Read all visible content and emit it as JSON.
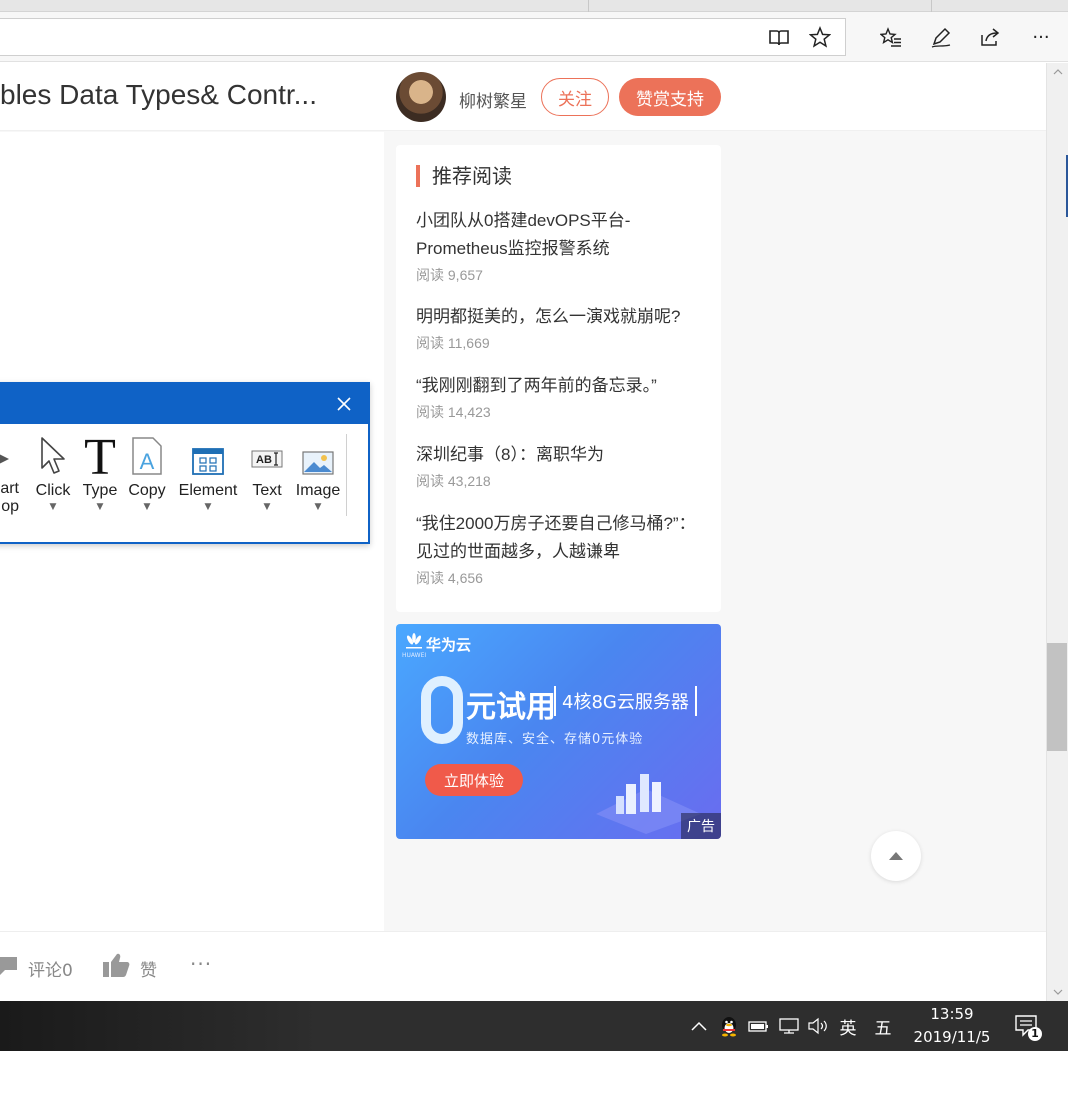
{
  "browser": {
    "toolbar_icons": [
      "reading-view-icon",
      "favorite-star-icon",
      "favorites-list-icon",
      "pen-icon",
      "share-icon",
      "more-icon"
    ],
    "more_label": "···"
  },
  "article": {
    "title": "bles Data Types& Contr...",
    "author": "柳树繁星",
    "follow_label": "关注",
    "tip_label": "赞赏支持"
  },
  "recommend": {
    "heading": "推荐阅读",
    "items": [
      {
        "title": "小团队从0搭建devOPS平台-Prometheus监控报警系统",
        "reads": "阅读 9,657"
      },
      {
        "title": "明明都挺美的，怎么一演戏就崩呢?",
        "reads": "阅读 11,669"
      },
      {
        "title": "“我刚刚翻到了两年前的备忘录。”",
        "reads": "阅读 14,423"
      },
      {
        "title": "深圳纪事（8）：离职华为",
        "reads": "阅读 43,218"
      },
      {
        "title": "“我住2000万房子还要自己修马桶?”：见过的世面越多，人越谦卑",
        "reads": "阅读 4,656"
      }
    ]
  },
  "ad": {
    "brand": "华为云",
    "brand_small": "HUAWEI",
    "headline": "元试用",
    "spec": "4核8G云服务器",
    "sub": "数据库、安全、存储0元体验",
    "cta": "立即体验",
    "label": "广告"
  },
  "bottom": {
    "comment_label": "评论0",
    "like_label": "赞",
    "more": "···"
  },
  "recorder": {
    "tools": [
      {
        "label": "art",
        "label2": "op",
        "icon": "play-icon"
      },
      {
        "label": "Click",
        "icon": "cursor-icon"
      },
      {
        "label": "Type",
        "icon": "type-t-icon"
      },
      {
        "label": "Copy",
        "icon": "copy-document-icon"
      },
      {
        "label": "Element",
        "icon": "element-window-icon"
      },
      {
        "label": "Text",
        "icon": "text-ocr-icon"
      },
      {
        "label": "Image",
        "icon": "image-icon"
      }
    ],
    "text_icon_glyph": "AB"
  },
  "taskbar": {
    "ime_lang": "英",
    "ime_mode": "五",
    "time": "13:59",
    "date": "2019/11/5",
    "notification_count": "1"
  },
  "colors": {
    "accent": "#ec7259",
    "recorder_blue": "#0f62c6",
    "ad_cta": "#f05a4a"
  }
}
